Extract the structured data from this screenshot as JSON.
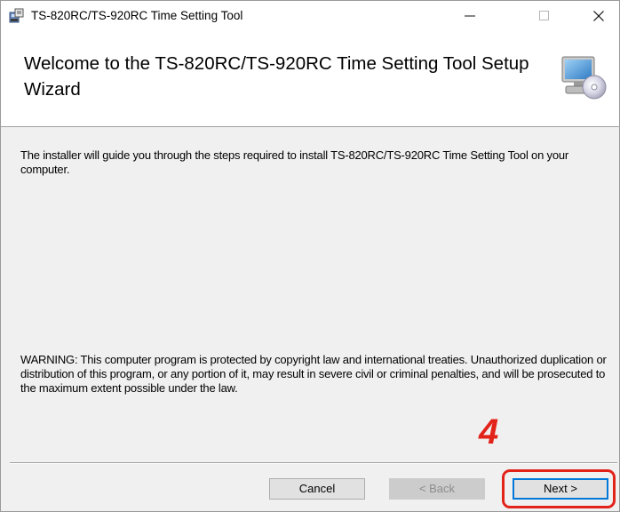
{
  "window": {
    "title": "TS-820RC/TS-920RC Time Setting Tool",
    "controls": {
      "minimize": "—",
      "maximize": "☐",
      "close": "✕"
    }
  },
  "header": {
    "title": "Welcome to the TS-820RC/TS-920RC Time Setting Tool Setup Wizard",
    "icon": "setup-computer-cd-icon"
  },
  "body": {
    "intro": "The installer will guide you through the steps required to install TS-820RC/TS-920RC Time Setting Tool on your computer.",
    "warning": "WARNING: This computer program is protected by copyright law and international treaties. Unauthorized duplication or distribution of this program, or any portion of it, may result in severe civil or criminal penalties, and will be prosecuted to the maximum extent possible under the law."
  },
  "annotation": {
    "step": "4",
    "color": "#e2231a"
  },
  "buttons": {
    "cancel": "Cancel",
    "back": "< Back",
    "next": "Next >"
  },
  "colors": {
    "accent": "#0078d7",
    "highlight": "#e2231a"
  }
}
